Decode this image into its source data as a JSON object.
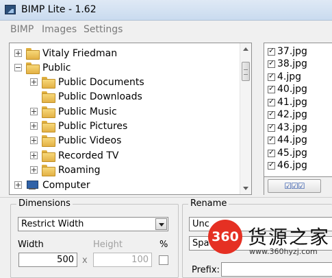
{
  "window": {
    "title": "BIMP Lite - 1.62"
  },
  "menu": [
    "BIMP",
    "Images",
    "Settings"
  ],
  "tree": [
    {
      "label": "Vitaly Friedman",
      "level": 0,
      "expander": "plus",
      "icon": "user-folder-icon"
    },
    {
      "label": "Public",
      "level": 0,
      "expander": "minus",
      "icon": "folder-icon"
    },
    {
      "label": "Public Documents",
      "level": 1,
      "expander": "plus",
      "icon": "documents-folder-icon"
    },
    {
      "label": "Public Downloads",
      "level": 1,
      "expander": "none",
      "icon": "folder-icon"
    },
    {
      "label": "Public Music",
      "level": 1,
      "expander": "plus",
      "icon": "music-folder-icon"
    },
    {
      "label": "Public Pictures",
      "level": 1,
      "expander": "plus",
      "icon": "pictures-folder-icon"
    },
    {
      "label": "Public Videos",
      "level": 1,
      "expander": "plus",
      "icon": "videos-folder-icon"
    },
    {
      "label": "Recorded TV",
      "level": 1,
      "expander": "plus",
      "icon": "folder-icon"
    },
    {
      "label": "Roaming",
      "level": 1,
      "expander": "plus",
      "icon": "folder-icon"
    },
    {
      "label": "Computer",
      "level": 0,
      "expander": "plus",
      "icon": "computer-icon"
    }
  ],
  "files": [
    {
      "name": "37.jpg",
      "checked": true
    },
    {
      "name": "38.jpg",
      "checked": true
    },
    {
      "name": "4.jpg",
      "checked": true
    },
    {
      "name": "40.jpg",
      "checked": true
    },
    {
      "name": "41.jpg",
      "checked": true
    },
    {
      "name": "42.jpg",
      "checked": true
    },
    {
      "name": "43.jpg",
      "checked": true
    },
    {
      "name": "44.jpg",
      "checked": true
    },
    {
      "name": "45.jpg",
      "checked": true
    },
    {
      "name": "46.jpg",
      "checked": true
    }
  ],
  "file_actions": {
    "check_all": "☑☑☑"
  },
  "dimensions": {
    "title": "Dimensions",
    "mode": "Restrict Width",
    "width_label": "Width",
    "width_value": "500",
    "height_label": "Height",
    "height_value": "100",
    "percent_label": "%",
    "separator": "x"
  },
  "rename": {
    "title": "Rename",
    "field1": "Unc",
    "field2": "Spa",
    "prefix_label": "Prefix:"
  },
  "watermark": {
    "badge": "360",
    "text": "货源之家",
    "url": "www.360hyzj.com"
  },
  "colors": {
    "watermark_badge": "#e53023",
    "titlebar": "#c9dbef"
  }
}
